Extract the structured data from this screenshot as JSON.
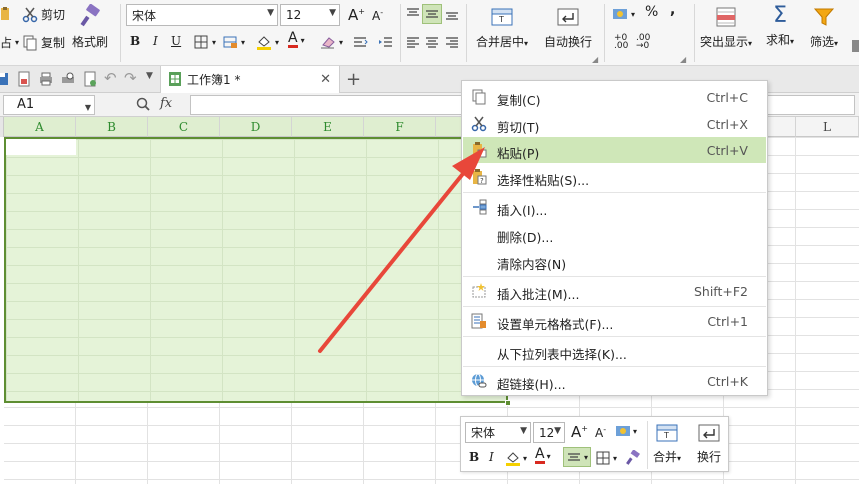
{
  "ribbon": {
    "clipboard": {
      "cut_label": "剪切",
      "copy_label": "复制",
      "format_painter_label": "格式刷",
      "paste_fragment": "占"
    },
    "font": {
      "name": "宋体",
      "size": "12",
      "bold": "B",
      "italic": "I",
      "underline": "U",
      "font_color_glyph": "A"
    },
    "alignment": {
      "merge_center_label": "合并居中",
      "wrap_text_label": "自动换行"
    },
    "number": {
      "percent": "%",
      "thousands": ","
    },
    "editing": {
      "highlight_label": "突出显示",
      "sum_label": "求和",
      "filter_label": "筛选"
    }
  },
  "tabbar": {
    "document_tab": "工作簿1 *",
    "new_tab_glyph": "+"
  },
  "formula_bar": {
    "name_box": "A1",
    "fx_label": "fx",
    "formula": ""
  },
  "grid": {
    "columns": [
      "A",
      "B",
      "C",
      "D",
      "E",
      "F",
      "",
      "",
      "",
      "",
      "",
      "L"
    ]
  },
  "context_menu": {
    "items": [
      {
        "label": "复制(C)",
        "shortcut": "Ctrl+C",
        "icon": "copy-icon"
      },
      {
        "label": "剪切(T)",
        "shortcut": "Ctrl+X",
        "icon": "scissors-icon"
      },
      {
        "label": "粘贴(P)",
        "shortcut": "Ctrl+V",
        "icon": "paste-icon",
        "highlighted": true
      },
      {
        "label": "选择性粘贴(S)...",
        "shortcut": "",
        "icon": "paste-special-icon"
      },
      {
        "label": "插入(I)...",
        "shortcut": "",
        "icon": "insert-icon"
      },
      {
        "label": "删除(D)...",
        "shortcut": "",
        "icon": ""
      },
      {
        "label": "清除内容(N)",
        "shortcut": "",
        "icon": ""
      },
      {
        "label": "插入批注(M)...",
        "shortcut": "Shift+F2",
        "icon": "comment-icon"
      },
      {
        "label": "设置单元格格式(F)...",
        "shortcut": "Ctrl+1",
        "icon": "format-cells-icon"
      },
      {
        "label": "从下拉列表中选择(K)...",
        "shortcut": "",
        "icon": ""
      },
      {
        "label": "超链接(H)...",
        "shortcut": "Ctrl+K",
        "icon": "hyperlink-icon"
      }
    ]
  },
  "mini_toolbar": {
    "font_name": "宋体",
    "font_size": "12",
    "merge_label": "合并",
    "wrap_label": "换行"
  },
  "colors": {
    "selection_fill": "#e5f3d8",
    "selection_border": "#5e8e32",
    "menu_highlight": "#cfe7b8",
    "arrow": "#e8473a"
  }
}
